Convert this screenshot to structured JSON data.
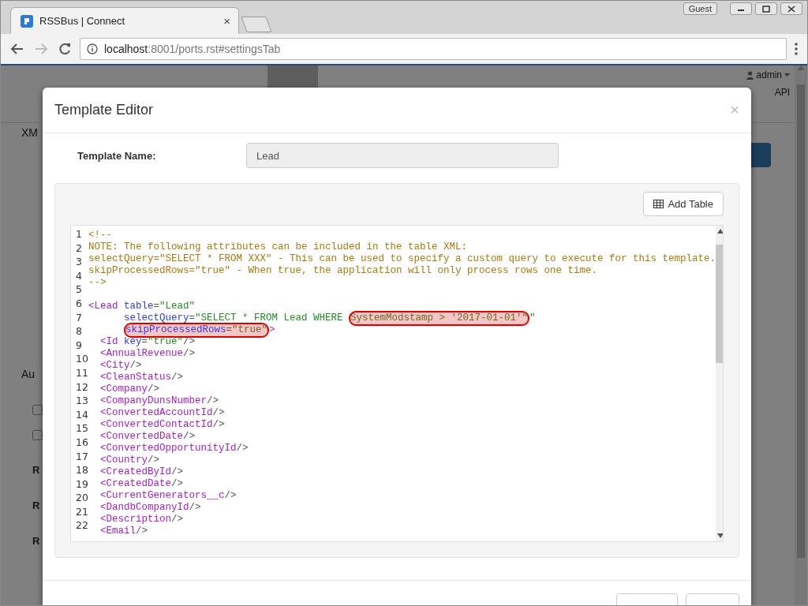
{
  "browser": {
    "tab_title": "RSSBus | Connect",
    "tab_close": "×",
    "guest": "Guest",
    "url_host": "localhost",
    "url_rest": ":8001/ports.rst#settingsTab"
  },
  "page": {
    "user": "admin",
    "api_link": "API",
    "section_1": "XM",
    "section_2": "Au",
    "checkboxes": [
      {
        "checked": false
      },
      {
        "checked": false
      }
    ],
    "labels": [
      "R",
      "R",
      "R"
    ]
  },
  "modal": {
    "title": "Template Editor",
    "close": "×",
    "template_name_label": "Template Name:",
    "template_name_value": "Lead",
    "add_table": "Add Table",
    "line_numbers": [
      "1",
      "2",
      "3",
      "4",
      "5",
      "6",
      "7",
      "8",
      "9",
      "10",
      "11",
      "12",
      "13",
      "14",
      "15",
      "16",
      "17",
      "18",
      "19",
      "20",
      "21",
      "22"
    ],
    "code_lines": [
      {
        "kind": "top",
        "tokens": [
          {
            "kind": "comment",
            "text": "<!--"
          }
        ]
      },
      {
        "kind": "top",
        "tokens": [
          {
            "kind": "comment",
            "text": "NOTE: The following attributes can be included in the table XML:"
          }
        ]
      },
      {
        "kind": "top",
        "tokens": [
          {
            "kind": "comment",
            "text": "selectQuery=\"SELECT * FROM XXX\" - This can be used to specify a custom query to execute for this template."
          }
        ]
      },
      {
        "kind": "top",
        "tokens": [
          {
            "kind": "comment",
            "text": "skipProcessedRows=\"true\" - When true, the application will only process rows one time."
          }
        ]
      },
      {
        "kind": "top",
        "tokens": [
          {
            "kind": "comment",
            "text": "-->"
          }
        ]
      },
      {
        "kind": "blank"
      },
      {
        "kind": "top",
        "tokens": [
          {
            "kind": "tag",
            "text": "<Lead"
          },
          {
            "kind": "attr",
            "text": " table"
          },
          {
            "kind": "punct",
            "text": "="
          },
          {
            "kind": "value",
            "text": "\"Lead\""
          }
        ]
      },
      {
        "kind": "attribute",
        "tokens": [
          {
            "kind": "attr",
            "text": "selectQuery"
          },
          {
            "kind": "punct",
            "text": "="
          },
          {
            "kind": "value",
            "text": "\"SELECT * FROM Lead WHERE "
          },
          {
            "kind": "marked",
            "text": "SystemModstamp > '2017-01-01'\"",
            "highlighted": true
          },
          {
            "kind": "value",
            "text": "\""
          }
        ]
      },
      {
        "kind": "attribute",
        "tokens": [
          {
            "kind": "attr",
            "text": "skipProcessedRows",
            "highlighted": true
          },
          {
            "kind": "punct",
            "text": "=",
            "highlighted": true
          },
          {
            "kind": "marked",
            "text": "\"true\"",
            "highlighted": true
          },
          {
            "kind": "tag",
            "text": ">"
          }
        ]
      },
      {
        "kind": "child",
        "tokens": [
          {
            "kind": "tag",
            "text": "<Id"
          },
          {
            "kind": "attr",
            "text": " key"
          },
          {
            "kind": "punct",
            "text": "="
          },
          {
            "kind": "value",
            "text": "\"true\""
          },
          {
            "kind": "punct",
            "text": "/>"
          }
        ]
      },
      {
        "kind": "child",
        "tokens": [
          {
            "kind": "tag",
            "text": "<AnnualRevenue"
          },
          {
            "kind": "punct",
            "text": "/>"
          }
        ]
      },
      {
        "kind": "child",
        "tokens": [
          {
            "kind": "tag",
            "text": "<City"
          },
          {
            "kind": "punct",
            "text": "/>"
          }
        ]
      },
      {
        "kind": "child",
        "tokens": [
          {
            "kind": "tag",
            "text": "<CleanStatus"
          },
          {
            "kind": "punct",
            "text": "/>"
          }
        ]
      },
      {
        "kind": "child",
        "tokens": [
          {
            "kind": "tag",
            "text": "<Company"
          },
          {
            "kind": "punct",
            "text": "/>"
          }
        ]
      },
      {
        "kind": "child",
        "tokens": [
          {
            "kind": "tag",
            "text": "<CompanyDunsNumber"
          },
          {
            "kind": "punct",
            "text": "/>"
          }
        ]
      },
      {
        "kind": "child",
        "tokens": [
          {
            "kind": "tag",
            "text": "<ConvertedAccountId"
          },
          {
            "kind": "punct",
            "text": "/>"
          }
        ]
      },
      {
        "kind": "child",
        "tokens": [
          {
            "kind": "tag",
            "text": "<ConvertedContactId"
          },
          {
            "kind": "punct",
            "text": "/>"
          }
        ]
      },
      {
        "kind": "child",
        "tokens": [
          {
            "kind": "tag",
            "text": "<ConvertedDate"
          },
          {
            "kind": "punct",
            "text": "/>"
          }
        ]
      },
      {
        "kind": "child",
        "tokens": [
          {
            "kind": "tag",
            "text": "<ConvertedOpportunityId"
          },
          {
            "kind": "punct",
            "text": "/>"
          }
        ]
      },
      {
        "kind": "child",
        "tokens": [
          {
            "kind": "tag",
            "text": "<Country"
          },
          {
            "kind": "punct",
            "text": "/>"
          }
        ]
      },
      {
        "kind": "child",
        "tokens": [
          {
            "kind": "tag",
            "text": "<CreatedById"
          },
          {
            "kind": "punct",
            "text": "/>"
          }
        ]
      },
      {
        "kind": "child",
        "tokens": [
          {
            "kind": "tag",
            "text": "<CreatedDate"
          },
          {
            "kind": "punct",
            "text": "/>"
          }
        ]
      },
      {
        "kind": "child",
        "tokens": [
          {
            "kind": "tag",
            "text": "<CurrentGenerators__c"
          },
          {
            "kind": "punct",
            "text": "/>"
          }
        ]
      },
      {
        "kind": "child",
        "tokens": [
          {
            "kind": "tag",
            "text": "<DandbCompanyId"
          },
          {
            "kind": "punct",
            "text": "/>"
          }
        ]
      },
      {
        "kind": "child",
        "tokens": [
          {
            "kind": "tag",
            "text": "<Description"
          },
          {
            "kind": "punct",
            "text": "/>"
          }
        ]
      },
      {
        "kind": "child",
        "tokens": [
          {
            "kind": "tag",
            "text": "<Email"
          },
          {
            "kind": "punct",
            "text": "/>"
          }
        ]
      }
    ]
  }
}
